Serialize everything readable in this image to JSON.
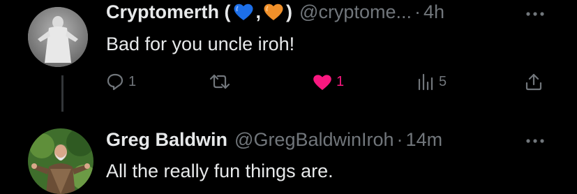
{
  "tweets": [
    {
      "author_name_prefix": "Cryptomerth (",
      "author_name_middle": ",",
      "author_name_suffix": ")",
      "handle": "@cryptome...",
      "dot": "·",
      "time": "4h",
      "text": "Bad for you uncle iroh!",
      "actions": {
        "replies": "1",
        "retweets": "",
        "likes": "1",
        "views": "5"
      },
      "liked": true,
      "heart_emojis": [
        "blue-heart",
        "orange-heart"
      ]
    },
    {
      "author_name": "Greg Baldwin",
      "handle": "@GregBaldwinIroh",
      "dot": "·",
      "time": "14m",
      "text": "All the really fun things are."
    }
  ],
  "colors": {
    "background": "#000000",
    "primary_text": "#e7e9ea",
    "secondary_text": "#71767b",
    "like_pink": "#f91880",
    "blue_heart": "#1d6fe8",
    "orange_heart": "#f0902a"
  }
}
